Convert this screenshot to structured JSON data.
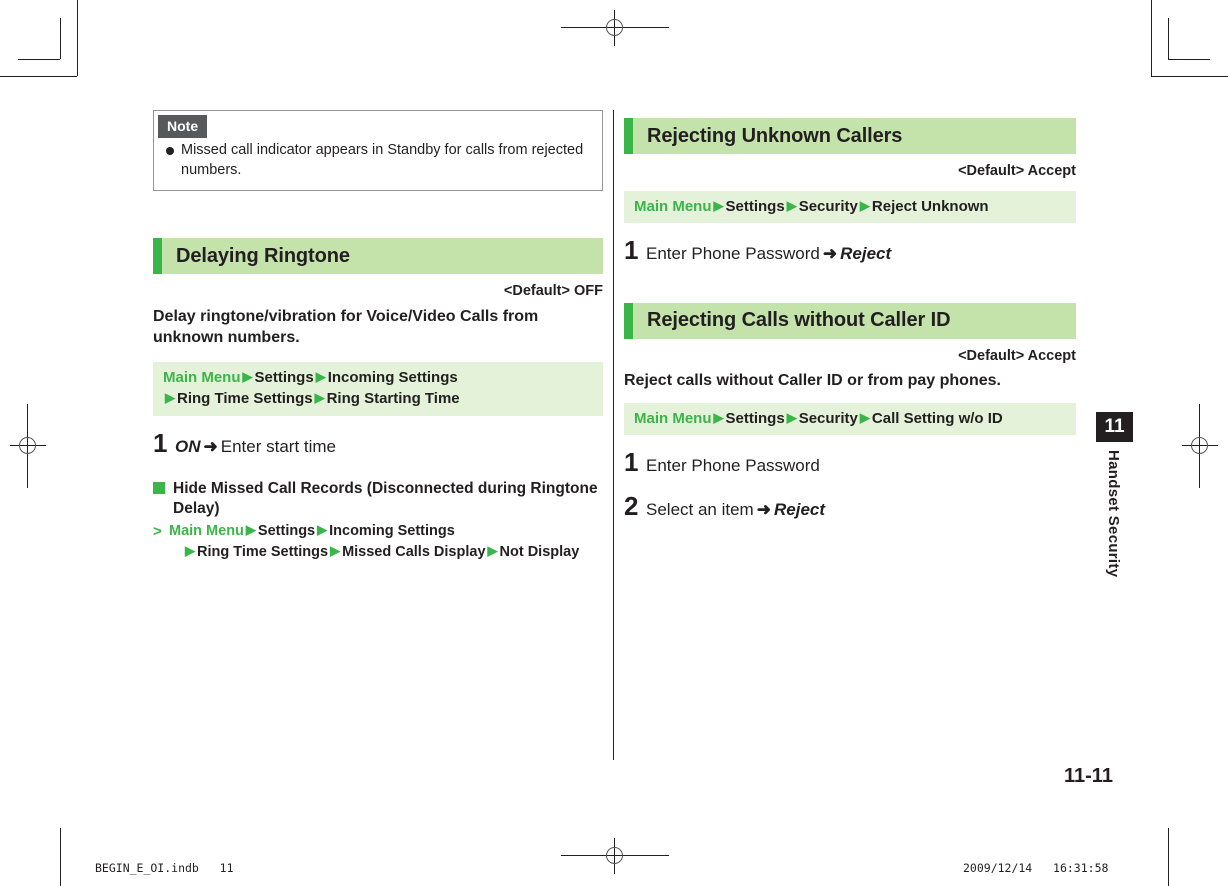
{
  "document": {
    "page_number": "11-11",
    "chapter_number": "11",
    "chapter_title": "Handset Security"
  },
  "footer": {
    "file_name": "BEGIN_E_OI.indb",
    "file_page": "11",
    "print_date": "2009/12/14",
    "print_time": "16:31:58"
  },
  "note": {
    "label": "Note",
    "items": [
      "Missed call indicator appears in Standby for calls from rejected numbers."
    ]
  },
  "left_column": {
    "section": {
      "title": "Delaying Ringtone",
      "default_label": "<Default> OFF",
      "description": "Delay ringtone/vibration for Voice/Video Calls from unknown numbers.",
      "path": {
        "root": "Main Menu",
        "crumbs": [
          "Settings",
          "Incoming Settings",
          "Ring Time Settings",
          "Ring Starting Time"
        ],
        "line1": "Main Menu ▶ Settings ▶ Incoming Settings",
        "line2": "▶ Ring Time Settings ▶ Ring Starting Time"
      },
      "steps": [
        {
          "num": "1",
          "emphasis": "ON",
          "arrow": "➜",
          "text": "Enter start time"
        }
      ]
    },
    "sub_section": {
      "title": "Hide Missed Call Records (Disconnected during Ringtone Delay)",
      "path": {
        "root": "Main Menu",
        "crumbs": [
          "Settings",
          "Incoming Settings",
          "Ring Time Settings",
          "Missed Calls Display",
          "Not Display"
        ]
      }
    }
  },
  "right_column": {
    "sections": [
      {
        "title": "Rejecting Unknown Callers",
        "default_label": "<Default> Accept",
        "description": "",
        "path": {
          "root": "Main Menu",
          "crumbs": [
            "Settings",
            "Security",
            "Reject Unknown"
          ]
        },
        "steps": [
          {
            "num": "1",
            "text": "Enter Phone Password",
            "arrow": "➜",
            "emphasis": "Reject"
          }
        ]
      },
      {
        "title": "Rejecting Calls without Caller ID",
        "default_label": "<Default> Accept",
        "description": "Reject calls without Caller ID or from pay phones.",
        "path": {
          "root": "Main Menu",
          "crumbs": [
            "Settings",
            "Security",
            "Call Setting w/o ID"
          ]
        },
        "steps": [
          {
            "num": "1",
            "text": "Enter Phone Password",
            "arrow": "",
            "emphasis": ""
          },
          {
            "num": "2",
            "text": "Select an item",
            "arrow": "➜",
            "emphasis": "Reject"
          }
        ]
      }
    ]
  },
  "colors": {
    "accent_green": "#39b54a",
    "band_green": "#e3f2d8",
    "header_green": "#c3e3ab",
    "text_green": "#3cb44a",
    "ink": "#231f20"
  }
}
